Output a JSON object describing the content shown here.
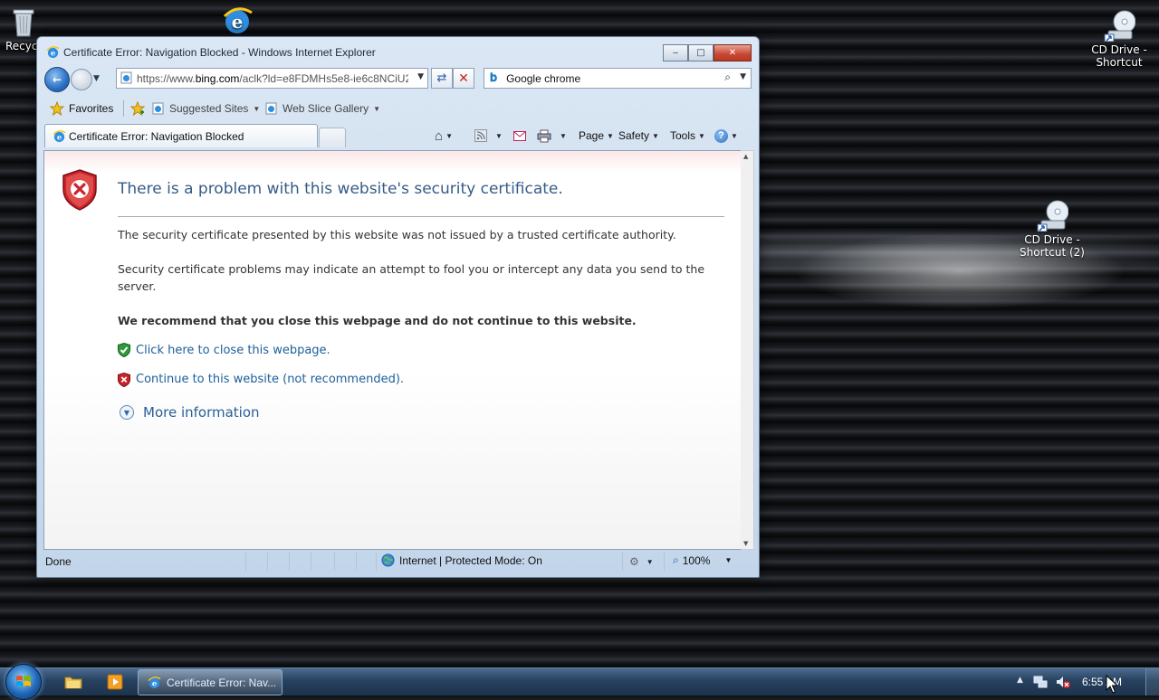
{
  "desktop": {
    "icons": [
      {
        "name": "recycle-bin",
        "label": "Recyc"
      },
      {
        "name": "internet-explorer",
        "label": ""
      },
      {
        "name": "cd-drive-shortcut",
        "label_line1": "CD Drive -",
        "label_line2": "Shortcut"
      },
      {
        "name": "cd-drive-shortcut-2",
        "label_line1": "CD Drive -",
        "label_line2": "Shortcut (2)"
      }
    ]
  },
  "window": {
    "title": "Certificate Error: Navigation Blocked - Windows Internet Explorer",
    "controls": {
      "minimize": "‒",
      "maximize": "□",
      "close": "✕"
    }
  },
  "nav": {
    "address_prefix": "https://www.",
    "address_domain": "bing.com",
    "address_rest": "/aclk?ld=e8FDMHs5e8-ie6c8NCiU2",
    "search_value": "Google chrome"
  },
  "favorites_bar": {
    "favorites_label": "Favorites",
    "links": [
      "Suggested Sites",
      "Web Slice Gallery"
    ]
  },
  "tabs": {
    "active_tab": "Certificate Error: Navigation Blocked"
  },
  "command_bar": {
    "page": "Page",
    "safety": "Safety",
    "tools": "Tools"
  },
  "content": {
    "title": "There is a problem with this website's security certificate.",
    "para1": "The security certificate presented by this website was not issued by a trusted certificate authority.",
    "para2": "Security certificate problems may indicate an attempt to fool you or intercept any data you send to the server.",
    "recommend": "We recommend that you close this webpage and do not continue to this website.",
    "close_link": "Click here to close this webpage.",
    "continue_link": "Continue to this website (not recommended).",
    "more_info": "More information"
  },
  "statusbar": {
    "status": "Done",
    "zone": "Internet | Protected Mode: On",
    "zoom": "100%"
  },
  "taskbar": {
    "task_label": "Certificate Error: Nav...",
    "clock": "6:55 AM"
  },
  "colors": {
    "link": "#1c5f9a",
    "title": "#355c87",
    "shield_red": "#c9242b"
  }
}
